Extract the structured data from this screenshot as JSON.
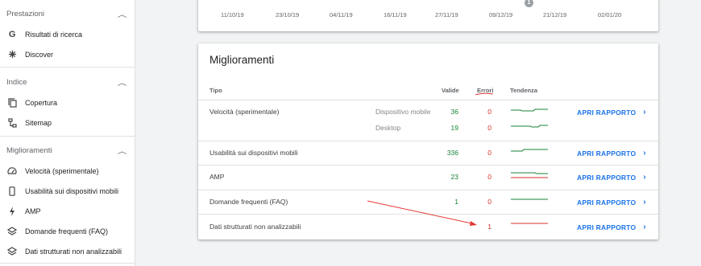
{
  "sidebar": {
    "sections": [
      {
        "title": "Prestazioni",
        "items": [
          "Risultati di ricerca",
          "Discover"
        ]
      },
      {
        "title": "Indice",
        "items": [
          "Copertura",
          "Sitemap"
        ]
      },
      {
        "title": "Miglioramenti",
        "items": [
          "Velocità (sperimentale)",
          "Usabilità sui dispositivi mobili",
          "AMP",
          "Domande frequenti (FAQ)",
          "Dati strutturati non analizzabili"
        ]
      }
    ]
  },
  "chart_axis": {
    "ticks": [
      "11/10/19",
      "23/10/19",
      "04/11/19",
      "16/11/19",
      "27/11/19",
      "09/12/19",
      "21/12/19",
      "02/01/20"
    ],
    "marker": "1"
  },
  "card": {
    "title": "Miglioramenti",
    "headers": {
      "type": "Tipo",
      "valid": "Valide",
      "errors": "Errori",
      "trend": "Tendenza"
    },
    "link_label": "APRI RAPPORTO",
    "rows": [
      {
        "type": "Velocità (sperimentale)",
        "device": "Dispositivo mobile",
        "valid": "36",
        "errors": "0"
      },
      {
        "type": "",
        "device": "Desktop",
        "valid": "19",
        "errors": "0"
      },
      {
        "type": "Usabilità sui dispositivi mobili",
        "device": "",
        "valid": "336",
        "errors": "0"
      },
      {
        "type": "AMP",
        "device": "",
        "valid": "23",
        "errors": "0"
      },
      {
        "type": "Domande frequenti (FAQ)",
        "device": "",
        "valid": "1",
        "errors": "0"
      },
      {
        "type": "Dati strutturati non analizzabili",
        "device": "",
        "valid": "",
        "errors": "1"
      }
    ]
  },
  "colors": {
    "valid": "#188038",
    "error": "#d93025",
    "link": "#1a73e8",
    "annotation": "#e53935"
  }
}
